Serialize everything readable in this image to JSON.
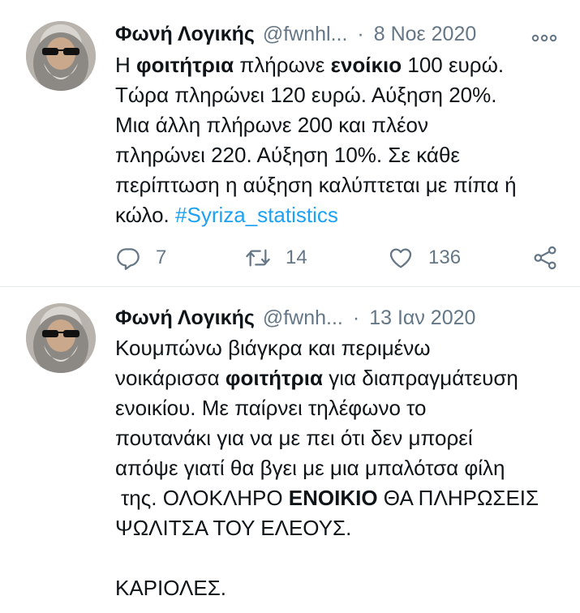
{
  "tweets": [
    {
      "name": "Φωνή Λογικής",
      "handle": "@fwnhl...",
      "dot": "·",
      "date": "8 Νοε 2020",
      "lines": [
        [
          "Η ",
          "φοιτήτρια",
          " πλήρωνε ",
          "ενοίκιο",
          " 100 ευρώ."
        ],
        [
          "Τώρα πληρώνει 120 ευρώ. Αύξηση 20%."
        ],
        [
          "Μια άλλη πλήρωνε 200 και πλέον"
        ],
        [
          "πληρώνει 220. Αύξηση 10%. Σε κάθε"
        ],
        [
          "περίπτωση η αύξηση καλύπτεται με πίπα ή"
        ],
        [
          "κώλο. ",
          "#Syriza_statistics"
        ]
      ],
      "replies": "7",
      "retweets": "14",
      "likes": "136"
    },
    {
      "name": "Φωνή Λογικής",
      "handle": "@fwnh...",
      "dot": "·",
      "date": "13 Ιαν 2020",
      "lines": [
        [
          "Κουμπώνω βιάγκρα και περιμένω"
        ],
        [
          "νοικάρισσα ",
          "φοιτήτρια",
          " για διαπραγμάτευση"
        ],
        [
          "ενοικίου. Με παίρνει τηλέφωνο το"
        ],
        [
          "πουτανάκι για να με πει ότι δεν μπορεί"
        ],
        [
          "απόψε γιατί θα βγει με μια μπαλότσα φίλη"
        ],
        [
          "της. ΟΛΟΚΛΗΡΟ ",
          "ΕΝΟΙΚΙΟ",
          " ΘΑ ΠΛΗΡΩΣΕΙΣ"
        ],
        [
          "ΨΩΛΙΤΣΑ ΤΟΥ ΕΛΕΟΥΣ."
        ],
        [
          "ΚΑΡΙΟΛΕΣ."
        ]
      ]
    }
  ],
  "icons": {
    "reply": "reply-icon",
    "retweet": "retweet-icon",
    "like": "heart-icon",
    "share": "share-icon",
    "more": "more-icon"
  },
  "colors": {
    "text": "#0f1419",
    "secondary": "#657786",
    "link": "#1da1f2",
    "divider": "#e6ecf0"
  }
}
